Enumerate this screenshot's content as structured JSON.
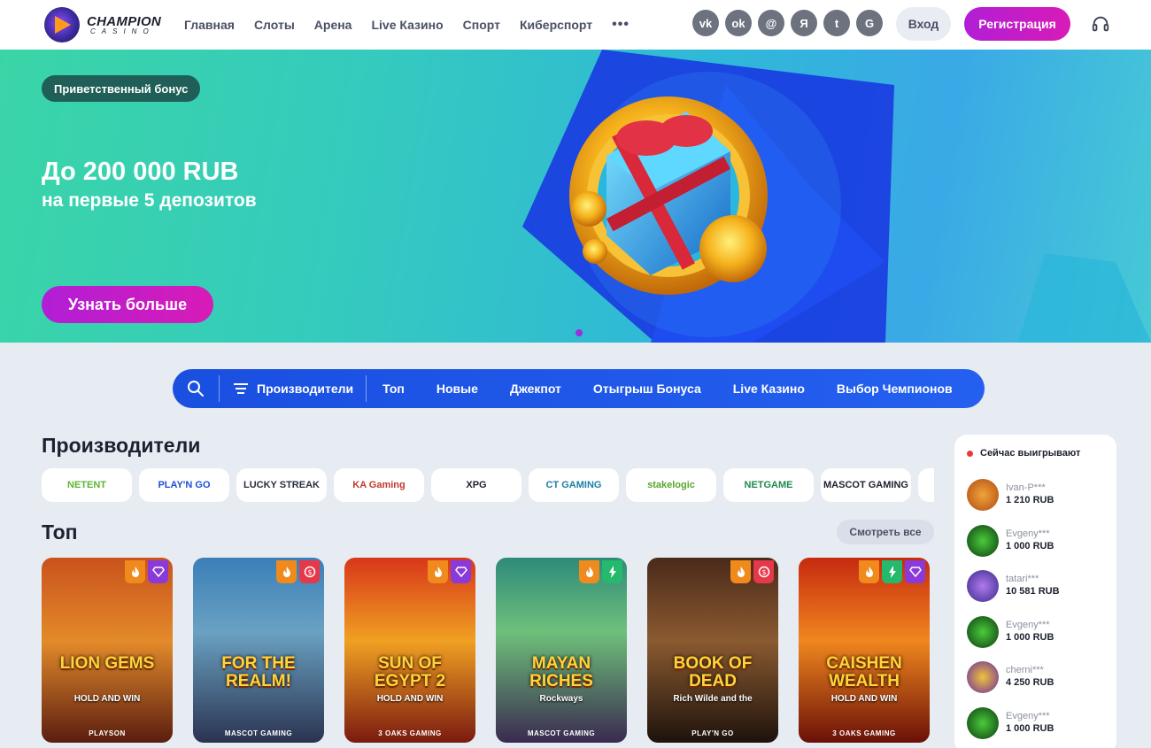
{
  "brand": {
    "name": "CHAMPION",
    "sub": "CASINO"
  },
  "nav": [
    "Главная",
    "Слоты",
    "Арена",
    "Live Казино",
    "Спорт",
    "Киберспорт",
    "•••"
  ],
  "socials": [
    {
      "label": "vk",
      "icon": "vk-icon"
    },
    {
      "label": "ok",
      "icon": "odnoklassniki-icon"
    },
    {
      "label": "@",
      "icon": "mail-icon"
    },
    {
      "label": "Я",
      "icon": "yandex-icon"
    },
    {
      "label": "t",
      "icon": "twitter-icon"
    },
    {
      "label": "G",
      "icon": "google-icon"
    }
  ],
  "header": {
    "login": "Вход",
    "register": "Регистрация"
  },
  "banner": {
    "tag": "Приветственный бонус",
    "title": "До 200 000 RUB",
    "subtitle": "на первые 5 депозитов",
    "cta": "Узнать больше"
  },
  "filters": {
    "providers_label": "Производители",
    "tabs": [
      "Топ",
      "Новые",
      "Джекпот",
      "Отыгрыш Бонуса",
      "Live Казино",
      "Выбор Чемпионов"
    ]
  },
  "providers": {
    "title": "Производители",
    "items": [
      {
        "label": "NETENT",
        "color": "#5db534"
      },
      {
        "label": "PLAY'N GO",
        "color": "#1e4fd8"
      },
      {
        "label": "LUCKY STREAK",
        "color": "#2a2f40"
      },
      {
        "label": "KA Gaming",
        "color": "#c0392b"
      },
      {
        "label": "XPG",
        "color": "#1c2030"
      },
      {
        "label": "CT GAMING",
        "color": "#1a7fa8"
      },
      {
        "label": "stakelogic",
        "color": "#56a82a"
      },
      {
        "label": "NETGAME",
        "color": "#1e8a4c"
      },
      {
        "label": "MASCOT GAMING",
        "color": "#1c2030"
      },
      {
        "label": "",
        "color": "#1c2030"
      }
    ]
  },
  "top": {
    "title": "Топ",
    "see_all": "Смотреть все",
    "games": [
      {
        "title": "LION GEMS",
        "sub": "HOLD AND WIN",
        "provider": "PLAYSON",
        "bg": "linear-gradient(180deg,#c9521c 0%,#e38a2a 45%,#5a1d10 100%)",
        "badges": [
          "fire",
          "gem"
        ]
      },
      {
        "title": "FOR THE REALM!",
        "sub": "",
        "provider": "MASCOT GAMING",
        "bg": "linear-gradient(180deg,#3a7fb8 0%,#6aa1c2 40%,#2a3350 100%)",
        "badges": [
          "fire",
          "cash"
        ]
      },
      {
        "title": "SUN OF EGYPT 2",
        "sub": "HOLD AND WIN",
        "provider": "3 OAKS GAMING",
        "bg": "linear-gradient(180deg,#d8361a 0%,#f0a022 45%,#7a1a10 100%)",
        "badges": [
          "fire",
          "gem"
        ]
      },
      {
        "title": "MAYAN RICHES",
        "sub": "Rockways",
        "provider": "MASCOT GAMING",
        "bg": "linear-gradient(180deg,#2e8a7a 0%,#6ec07a 40%,#3a2a50 100%)",
        "badges": [
          "fire",
          "bolt"
        ]
      },
      {
        "title": "BOOK OF DEAD",
        "sub": "Rich Wilde and the",
        "provider": "PLAY'N GO",
        "bg": "linear-gradient(180deg,#4a2a1a 0%,#8a5a30 45%,#1e120c 100%)",
        "badges": [
          "fire",
          "cash"
        ]
      },
      {
        "title": "CAISHEN WEALTH",
        "sub": "HOLD AND WIN",
        "provider": "3 OAKS GAMING",
        "bg": "linear-gradient(180deg,#c62a10 0%,#f0861e 45%,#6a1008 100%)",
        "badges": [
          "fire",
          "bolt",
          "gem"
        ]
      }
    ]
  },
  "winners": {
    "title": "Сейчас выигрывают",
    "items": [
      {
        "name": "Ivan-P***",
        "amount": "1 210 RUB",
        "color": "radial-gradient(circle,#f0a43a,#b24a12)"
      },
      {
        "name": "Evgeny***",
        "amount": "1 000 RUB",
        "color": "radial-gradient(circle,#4acc3a,#0c3a12)"
      },
      {
        "name": "tatari***",
        "amount": "10 581 RUB",
        "color": "radial-gradient(circle,#b07af0,#3a2a8a)"
      },
      {
        "name": "Evgeny***",
        "amount": "1 000 RUB",
        "color": "radial-gradient(circle,#4acc3a,#0c3a12)"
      },
      {
        "name": "cherni***",
        "amount": "4 250 RUB",
        "color": "radial-gradient(circle,#f0c43a,#6a2aa0)"
      },
      {
        "name": "Evgeny***",
        "amount": "1 000 RUB",
        "color": "radial-gradient(circle,#4acc3a,#0c3a12)"
      }
    ]
  }
}
